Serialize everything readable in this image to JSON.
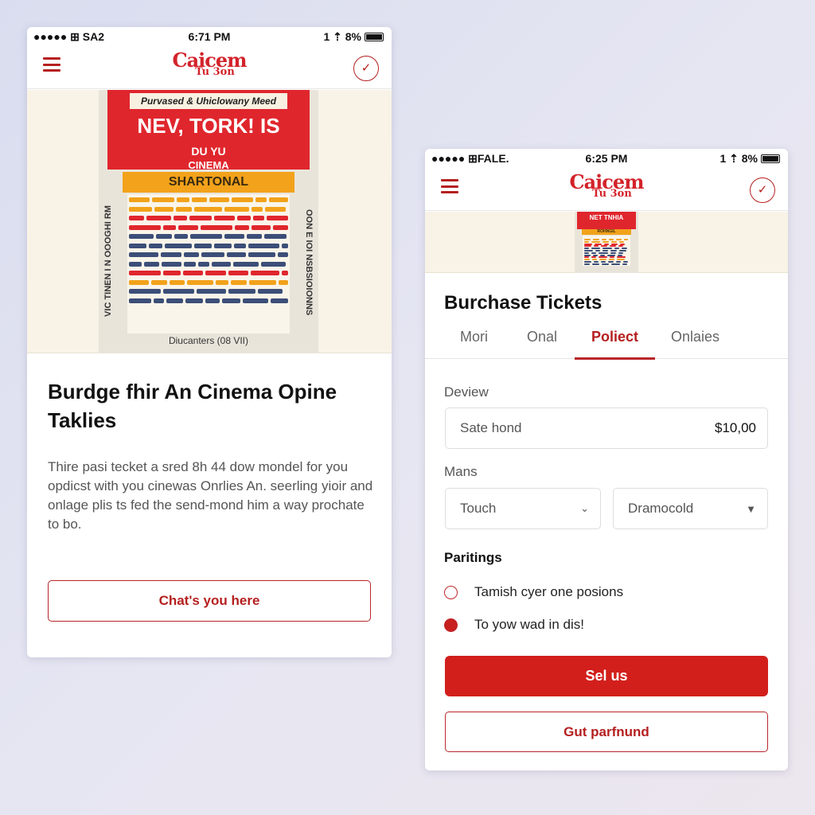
{
  "colors": {
    "accent": "#d21f1b",
    "accent_dark": "#b51f1f",
    "poster_red": "#e0262d",
    "poster_yellow": "#f2a21b",
    "poster_blue": "#3c4e78",
    "band": "#f8f3e6"
  },
  "left_phone": {
    "status": {
      "carrier": "●●●●● ⊞ SA2",
      "time": "6:71 PM",
      "right": "1 ⇡ 8%"
    },
    "logo": {
      "line1": "Caicem",
      "line2": "Tu 3on"
    },
    "poster": {
      "tagline": "Purvased & Uhiclowany Meed",
      "title": "NEV, TORK! IS",
      "subtitle1": "DU YU",
      "subtitle2": "CINEMA",
      "banner": "SHARTONAL",
      "left_vertical": "VIC TINEN I N OOOGHI RM",
      "right_vertical": "OON E IOI NSBSIOIONNS",
      "footer": "Diucanters (08 VII)"
    },
    "heading": "Burdge fhir An Cinema Opine Taklies",
    "body": "Thire pasi tecket a sred 8h 44 dow mondel for you opdicst with you cinewas Onrlies An. seerling yioir and onlage plis ts fed the send-mond him a way prochate to bo.",
    "button": "Chat's you here"
  },
  "right_phone": {
    "status": {
      "carrier": "●●●●● ⊞FALE.",
      "time": "6:25 PM",
      "right": "1 ⇡ 8%"
    },
    "logo": {
      "line1": "Caicem",
      "line2": "Tu 3on"
    },
    "poster": {
      "title": "NET TNHIA",
      "banner": "ROHNGIL"
    },
    "title": "Burchase Tickets",
    "tabs": [
      {
        "label": "Mori"
      },
      {
        "label": "Onal"
      },
      {
        "label": "Poliect",
        "active": true
      },
      {
        "label": "Onlaies"
      }
    ],
    "deview_label": "Deview",
    "deview_field": {
      "value": "Sate hond",
      "price": "$10,00"
    },
    "mans_label": "Mans",
    "select1": "Touch",
    "select2": "Dramocold",
    "section": "Paritings",
    "options": [
      {
        "label": "Tamish cyer one posions",
        "selected": false
      },
      {
        "label": "To yow wad in dis!",
        "selected": true
      }
    ],
    "primary_button": "Sel us",
    "secondary_button": "Gut parfnund"
  }
}
